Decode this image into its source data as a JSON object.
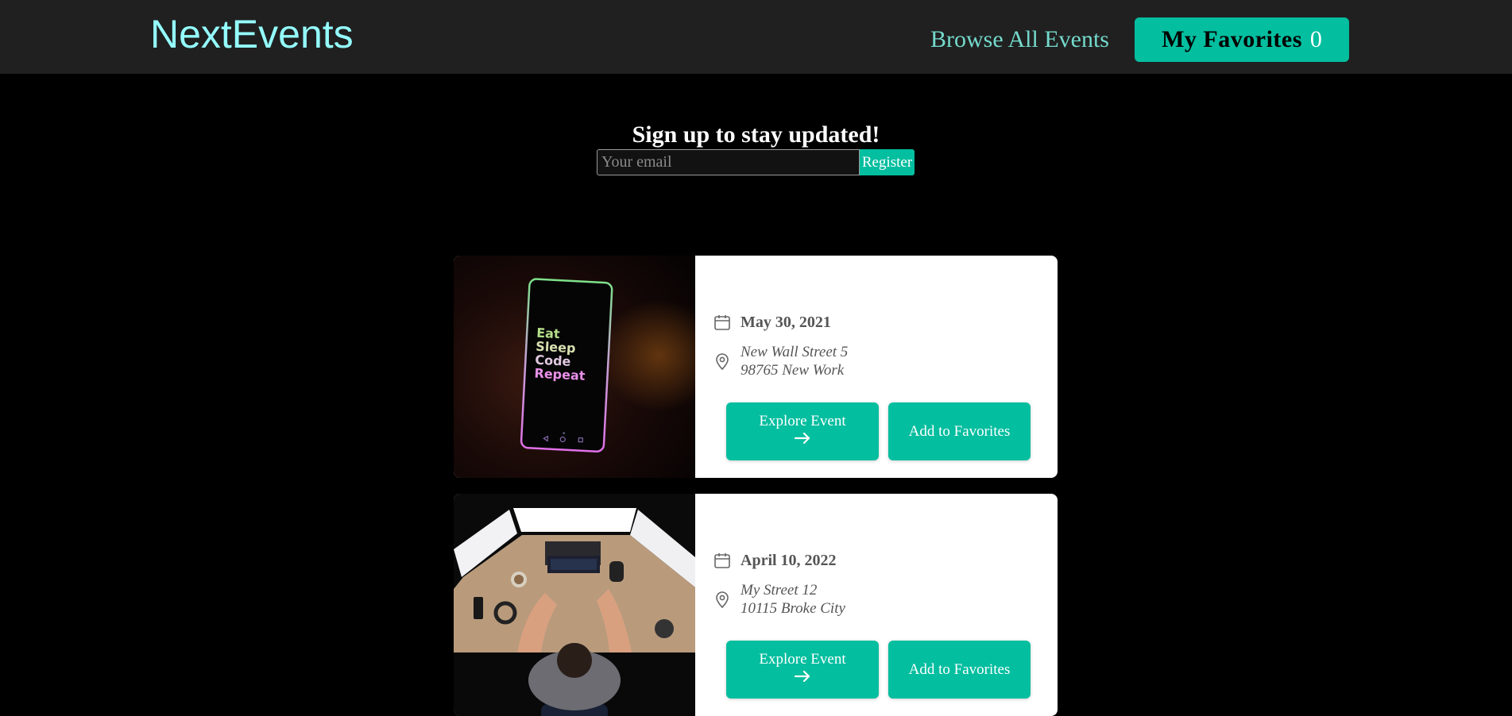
{
  "header": {
    "logo": "NextEvents",
    "nav_browse": "Browse All Events",
    "favorites_label": "My Favorites",
    "favorites_count": "0"
  },
  "signup": {
    "title": "Sign up to stay updated!",
    "placeholder": "Your email",
    "button": "Register"
  },
  "events": [
    {
      "date": "May 30, 2021",
      "address_line1": "New Wall Street 5",
      "address_line2": "98765 New Work",
      "explore_label": "Explore Event",
      "favorite_label": "Add to Favorites",
      "image_text": [
        "Eat",
        "Sleep",
        "Code",
        "Repeat"
      ]
    },
    {
      "date": "April 10, 2022",
      "address_line1": "My Street 12",
      "address_line2": "10115 Broke City",
      "explore_label": "Explore Event",
      "favorite_label": "Add to Favorites"
    }
  ],
  "colors": {
    "accent": "#03be9f",
    "logo": "#94fdfd",
    "nav_link": "#74dacc",
    "header_bg": "#202020"
  },
  "icons": {
    "date": "calendar-icon",
    "address": "map-pin-icon",
    "explore": "arrow-right-icon"
  }
}
